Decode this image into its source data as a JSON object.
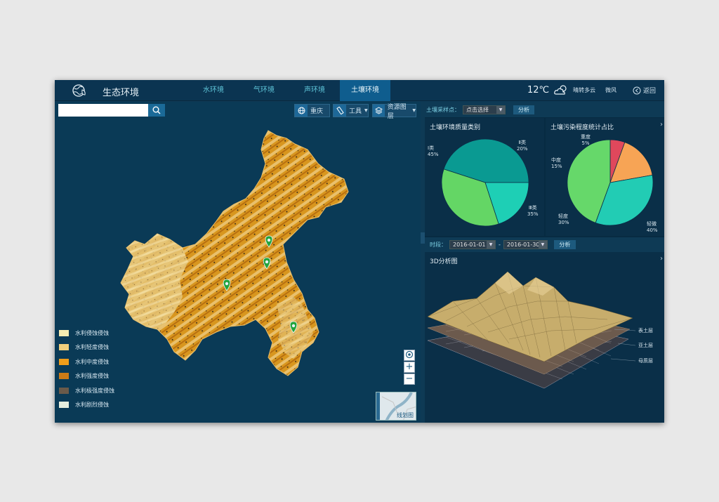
{
  "header": {
    "title": "生态环境",
    "tabs": [
      "水环境",
      "气环境",
      "声环境",
      "土壤环境"
    ],
    "active_tab": 3,
    "temperature": "12℃",
    "weather_desc": "晴转多云",
    "wind": "微风",
    "back_label": "返回"
  },
  "map": {
    "search_placeholder": "",
    "city_label": "重庆",
    "tools_label": "工具",
    "layers_label": "资源图层",
    "thumbnail_label": "线划图",
    "zoom_in": "+",
    "zoom_out": "−",
    "legend": [
      {
        "label": "水利侵蚀侵蚀",
        "color": "#f5ecb2"
      },
      {
        "label": "水利轻度侵蚀",
        "color": "#f0cf7c"
      },
      {
        "label": "水利中度侵蚀",
        "color": "#ef9d1a"
      },
      {
        "label": "水利强度侵蚀",
        "color": "#cc7b16"
      },
      {
        "label": "水利极强度侵蚀",
        "color": "#6a5a4a"
      },
      {
        "label": "水利剧烈侵蚀",
        "color": "#e6eede"
      }
    ]
  },
  "soil_toolbar": {
    "label": "土壤采样点：",
    "select_value": "点击选择",
    "analyze_label": "分析"
  },
  "quality_chart": {
    "title": "土壤环境质量类别",
    "chart_data": {
      "type": "pie",
      "title": "土壤环境质量类别",
      "labels": [
        "Ⅰ类",
        "Ⅱ类",
        "Ⅲ类"
      ],
      "values": [
        45,
        20,
        35
      ],
      "value_labels": [
        "45%",
        "20%",
        "35%"
      ],
      "colors": [
        "#0a9a92",
        "#1ecfb5",
        "#64d665"
      ]
    }
  },
  "pollution_chart": {
    "title": "土壤污染程度统计占比",
    "chart_data": {
      "type": "pie",
      "title": "土壤污染程度统计占比",
      "labels": [
        "重度",
        "中度",
        "轻度",
        "轻微"
      ],
      "values": [
        5,
        15,
        30,
        40
      ],
      "value_labels": [
        "5%",
        "15%",
        "30%",
        "40%"
      ],
      "colors": [
        "#e0485c",
        "#f7a455",
        "#22ccb4",
        "#66d86a"
      ]
    }
  },
  "period": {
    "label": "时段：",
    "start": "2016-01-01",
    "separator": "-",
    "end": "2016-01-30",
    "analyze_label": "分析"
  },
  "analysis3d": {
    "title": "3D分析图",
    "layers": [
      "表土层",
      "亚土层",
      "母质层"
    ]
  }
}
